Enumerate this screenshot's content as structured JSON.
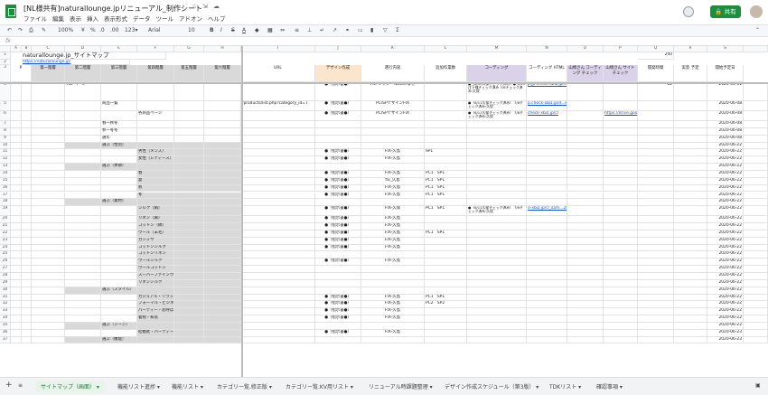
{
  "app": {
    "title": "[NL様共有]naturallounge.jpリニューアル_制作シート",
    "menus": [
      "ファイル",
      "編集",
      "表示",
      "挿入",
      "表示形式",
      "データ",
      "ツール",
      "アドオン",
      "ヘルプ"
    ],
    "share_label": "共有"
  },
  "toolbar": {
    "zoom": "100%",
    "currency": "¥",
    "percent": "%",
    "dec1": ".0",
    "dec2": ".00",
    "numfmt": "123▾",
    "font": "Arial",
    "size": "10",
    "bold": "B",
    "italic": "I",
    "strike": "S",
    "textcolor": "A"
  },
  "formula_bar": {
    "label": "fx",
    "value": ""
  },
  "columns": [
    "A",
    "B",
    "C",
    "D",
    "E",
    "F",
    "G",
    "H",
    "I",
    "J",
    "K",
    "L",
    "M",
    "N",
    "O",
    "P",
    "Q",
    "R",
    "S",
    "T"
  ],
  "sheet": {
    "r1": {
      "title": "naturallounge.jp_サイトマップ",
      "count": "240"
    },
    "r2": {
      "url": "https://naturallounge.jp/"
    },
    "headers": {
      "p": "P",
      "lv1": "第一階層",
      "lv2": "第二階層",
      "lv3": "第三階層",
      "lv4": "第四階層",
      "lv5": "第五階層",
      "lv6": "第六階層",
      "url": "URL",
      "design": "デザイン作成",
      "content": "遣行内容",
      "add": "追加作業数",
      "coding": "コーディング",
      "coding_html": "コーディング HTML",
      "yamaguchi_check": "山崎さん コーディング チェック",
      "yamaguchi_site": "山崎さん サイト チェック",
      "hours": "開発時間",
      "actual": "実装 予定",
      "start": "開始予定日"
    },
    "rows": [
      {
        "n": "4",
        "lv1": "",
        "lv2": "TOPページ",
        "lv3": "",
        "lv4": "",
        "url": "/",
        "design": "●（指示書●）",
        "content": "FIX フッターTwitterなし",
        "add": "",
        "coding": "●（6/10久保チェック済み）● 6/15注下様チェック済み 7/6チェック済み:久保",
        "html": "p.jp-check-xbiz.jp/9aW9UsQY8x",
        "ych": "",
        "ysite": "",
        "hours": "12",
        "actual": "",
        "start": "2020-06-01"
      },
      {
        "n": "5",
        "lv1": "",
        "lv2": "",
        "lv3": "商品一覧",
        "lv4": "",
        "url": "/products/list.php?category_id=7",
        "design": "●（指示書●）",
        "content": "PC/SPデザインFIX",
        "add": "",
        "coding": "●（6/11久保チェック済み） 7/6チェック済み:久保",
        "html": "p.check-xbiz.jp/d...kfYkG5_kqUUg",
        "ych": "",
        "ysite": "",
        "hours": "",
        "actual": "",
        "start": "2020-06-08"
      },
      {
        "n": "6",
        "lv1": "",
        "lv2": "",
        "lv3": "",
        "lv4": "各商品ページ",
        "url": "",
        "design": "●（指示書●）",
        "content": "PC/SPデザインFIX",
        "add": "",
        "coding": "●（6/11久保チェック済み） 7/6チェック済み:久保",
        "html": "check-xbiz.jp/cl",
        "ych": "",
        "ysite": "https://drive.google.com/drive/u/0/f",
        "hours": "",
        "actual": "",
        "start": "2020-06-08"
      },
      {
        "n": "7",
        "lv2": "",
        "lv3": "春一秋冬",
        "start": "2020-06-08"
      },
      {
        "n": "8",
        "lv3": "秋一冬冬",
        "start": "2020-06-08"
      },
      {
        "n": "9",
        "lv3": "通年",
        "start": "2020-06-08"
      },
      {
        "n": "10",
        "lv3": "選ぶ（性別）",
        "cat": true,
        "start": "2020-06-22"
      },
      {
        "n": "11",
        "lv4": "男性（メンズ）",
        "design": "●（指示書●）",
        "content": "FIX-久島",
        "add": "SP1",
        "start": "2020-06-22"
      },
      {
        "n": "12",
        "lv4": "女性（レディース）",
        "design": "●（指示書●）",
        "content": "FIX-久島",
        "add": "",
        "start": "2020-06-22"
      },
      {
        "n": "13",
        "lv3": "選ぶ（季節）",
        "cat": true,
        "start": "2020-06-22"
      },
      {
        "n": "14",
        "lv4": "春",
        "design": "●（指示書●）",
        "content": "FIX-久島",
        "add": "PC1　SP1",
        "start": "2020-06-22"
      },
      {
        "n": "15",
        "lv4": "夏",
        "design": "●（指示書●）",
        "content": "fix_久島",
        "add": "PC1　SP1",
        "start": "2020-06-22"
      },
      {
        "n": "16",
        "lv4": "秋",
        "design": "●（指示書●）",
        "content": "FIX-久島",
        "add": "PC1　SP1",
        "start": "2020-06-22"
      },
      {
        "n": "17",
        "lv4": "冬",
        "design": "●（指示書●）",
        "content": "FIX-久島",
        "add": "PC1　SP1",
        "start": "2020-06-22"
      },
      {
        "n": "18",
        "lv3": "選ぶ（素材）",
        "cat": true,
        "start": "2020-06-22"
      },
      {
        "n": "19",
        "lv4": "シルク（絹）",
        "design": "●（指示書●）",
        "content": "FIX-久保",
        "add": "PC1　SP1",
        "coding": "●（6/11久保チェック済み） 7/6チェック済み:久保",
        "html": "o-xbiz.jp/cl_sam...2Pha8pU7D3E",
        "start": "2020-06-22"
      },
      {
        "n": "20",
        "lv4": "リネン（麻）",
        "design": "●（指示書●）",
        "content": "FIX-久島",
        "start": "2020-06-22"
      },
      {
        "n": "21",
        "lv4": "コットン（綿）",
        "design": "●（指示書●）",
        "content": "FIX-久島",
        "start": "2020-06-22"
      },
      {
        "n": "22",
        "lv4": "ウール（羊毛）",
        "design": "●（指示書●）",
        "content": "FIX-久島",
        "add": "PC1　SP1",
        "start": "2020-06-22"
      },
      {
        "n": "23",
        "lv4": "カシミヤ",
        "design": "●（指示書●）",
        "content": "FIX-久島",
        "start": "2020-06-22"
      },
      {
        "n": "24",
        "lv4": "コットンシルク",
        "design": "●（指示書●）",
        "content": "FIX-久島",
        "start": "2020-06-22"
      },
      {
        "n": "25",
        "lv4": "コットンリネン",
        "start": "2020-06-22"
      },
      {
        "n": "26",
        "lv4": "ウールシルク",
        "design": "●（指示書●）",
        "content": "FIX-久島",
        "start": "2020-06-22"
      },
      {
        "n": "27",
        "lv4": "ウールコットン",
        "start": "2020-06-22"
      },
      {
        "n": "28",
        "lv4": "スーパーファインウール",
        "start": "2020-06-22"
      },
      {
        "n": "29",
        "lv4": "リネンシルク",
        "start": "2020-06-22"
      },
      {
        "n": "30",
        "lv3": "選ぶ（スタイル）",
        "cat": true,
        "start": "2020-06-22"
      },
      {
        "n": "31",
        "lv4": "カジュアル・リラックス",
        "design": "●（指示書●）",
        "content": "FIX-久島",
        "add": "PC1　SP1",
        "start": "2020-06-22"
      },
      {
        "n": "32",
        "lv4": "フォーマル・ビジネス",
        "design": "●（指示書●）",
        "content": "FIX-久島",
        "add": "PC2　SP2",
        "start": "2020-06-22"
      },
      {
        "n": "33",
        "lv4": "パーティー・お呼ばれ",
        "design": "●（指示書●）",
        "content": "FIX-久島",
        "start": "2020-06-22"
      },
      {
        "n": "34",
        "lv4": "着物・和装",
        "design": "●（指示書●）",
        "content": "FIX-久島",
        "start": "2020-06-22"
      },
      {
        "n": "35",
        "lv3": "選ぶ（シーン）",
        "cat": true,
        "start": "2020-06-22"
      },
      {
        "n": "36",
        "lv4": "結婚式・パーティー",
        "design": "●（指示書●）",
        "content": "FIX-久島",
        "start": "2020-06-23"
      },
      {
        "n": "37",
        "lv3": "選ぶ（機能）",
        "cat": true,
        "start": "2020-06-23"
      }
    ]
  },
  "tabs": [
    "サイトマップ（画面）",
    "機能リスト進捗",
    "機能リスト",
    "カテゴリー覧.修正版",
    "カテゴリー覧.KV用リスト",
    "リニューアル時課題整理",
    "デザイン作成スケジュール（第3版）",
    "TDKリスト",
    "確認事項"
  ],
  "active_tab": 0
}
